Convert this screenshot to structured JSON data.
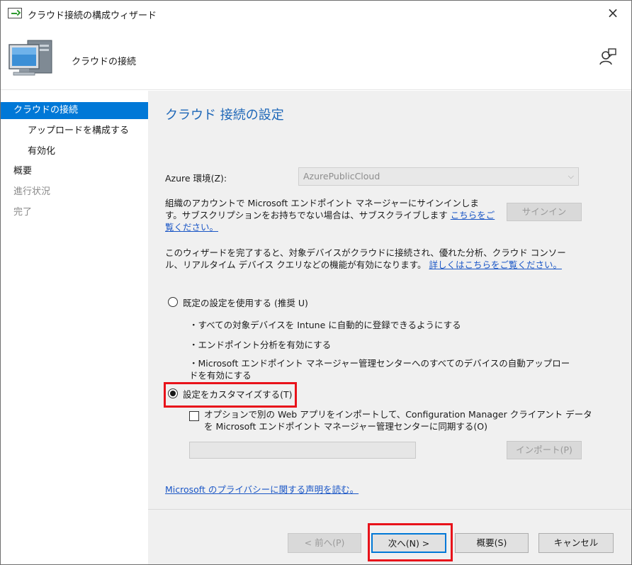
{
  "window": {
    "title": "クラウド接続の構成ウィザード",
    "close_label": "×"
  },
  "header": {
    "title": "クラウドの接続"
  },
  "nav": {
    "items": [
      {
        "label": "クラウドの接続",
        "state": "active"
      },
      {
        "label": "アップロードを構成する",
        "state": "sub"
      },
      {
        "label": "有効化",
        "state": "sub"
      },
      {
        "label": "概要",
        "state": "normal"
      },
      {
        "label": "進行状況",
        "state": "disabled"
      },
      {
        "label": "完了",
        "state": "disabled"
      }
    ]
  },
  "main": {
    "section_title": "クラウド 接続の設定",
    "azure_label": "Azure 環境(Z):",
    "azure_value": "AzurePublicCloud",
    "signin_text_line1": "組織のアカウントで Microsoft エンドポイント マネージャーにサインインしま",
    "signin_text_line2": "す。サブスクリプションをお持ちでない場合は、サブスクライブします",
    "signin_link_part1": "こちらをご",
    "signin_link_part2": "覧ください。",
    "signin_button": "サインイン",
    "info_line1": "このウィザードを完了すると、対象デバイスがクラウドに接続され、優れた分析、クラウド コンソー",
    "info_line2": "ル、リアルタイム デバイス クエリなどの機能が有効になります。",
    "info_link": "詳しくはこちらをご覧ください。",
    "radio_default": "既定の設定を使用する (推奨 U)",
    "bullet1": "・すべての対象デバイスを Intune に自動的に登録できるようにする",
    "bullet2": "・エンドポイント分析を有効にする",
    "bullet3_line1": "・Microsoft エンドポイント マネージャー管理センターへのすべてのデバイスの自動アップロー",
    "bullet3_line2": "ドを有効にする",
    "radio_custom": "設定をカスタマイズする(T)",
    "checkbox_line1": "オプションで別の Web アプリをインポートして、Configuration Manager クライアント データ",
    "checkbox_line2": "を Microsoft エンドポイント マネージャー管理センターに同期する(O)",
    "import_button": "インポート(P)",
    "privacy_link": "Microsoft のプライバシーに関する声明を読む。",
    "selected_option": "custom"
  },
  "footer": {
    "back_button": "< 前へ(P)",
    "next_button": "次へ(N) >",
    "summary_button": "概要(S)",
    "cancel_button": "キャンセル"
  },
  "colors": {
    "accent": "#0078d7",
    "link": "#1a56c6",
    "highlight_box": "#e8121a",
    "section_title": "#1e67b8"
  }
}
